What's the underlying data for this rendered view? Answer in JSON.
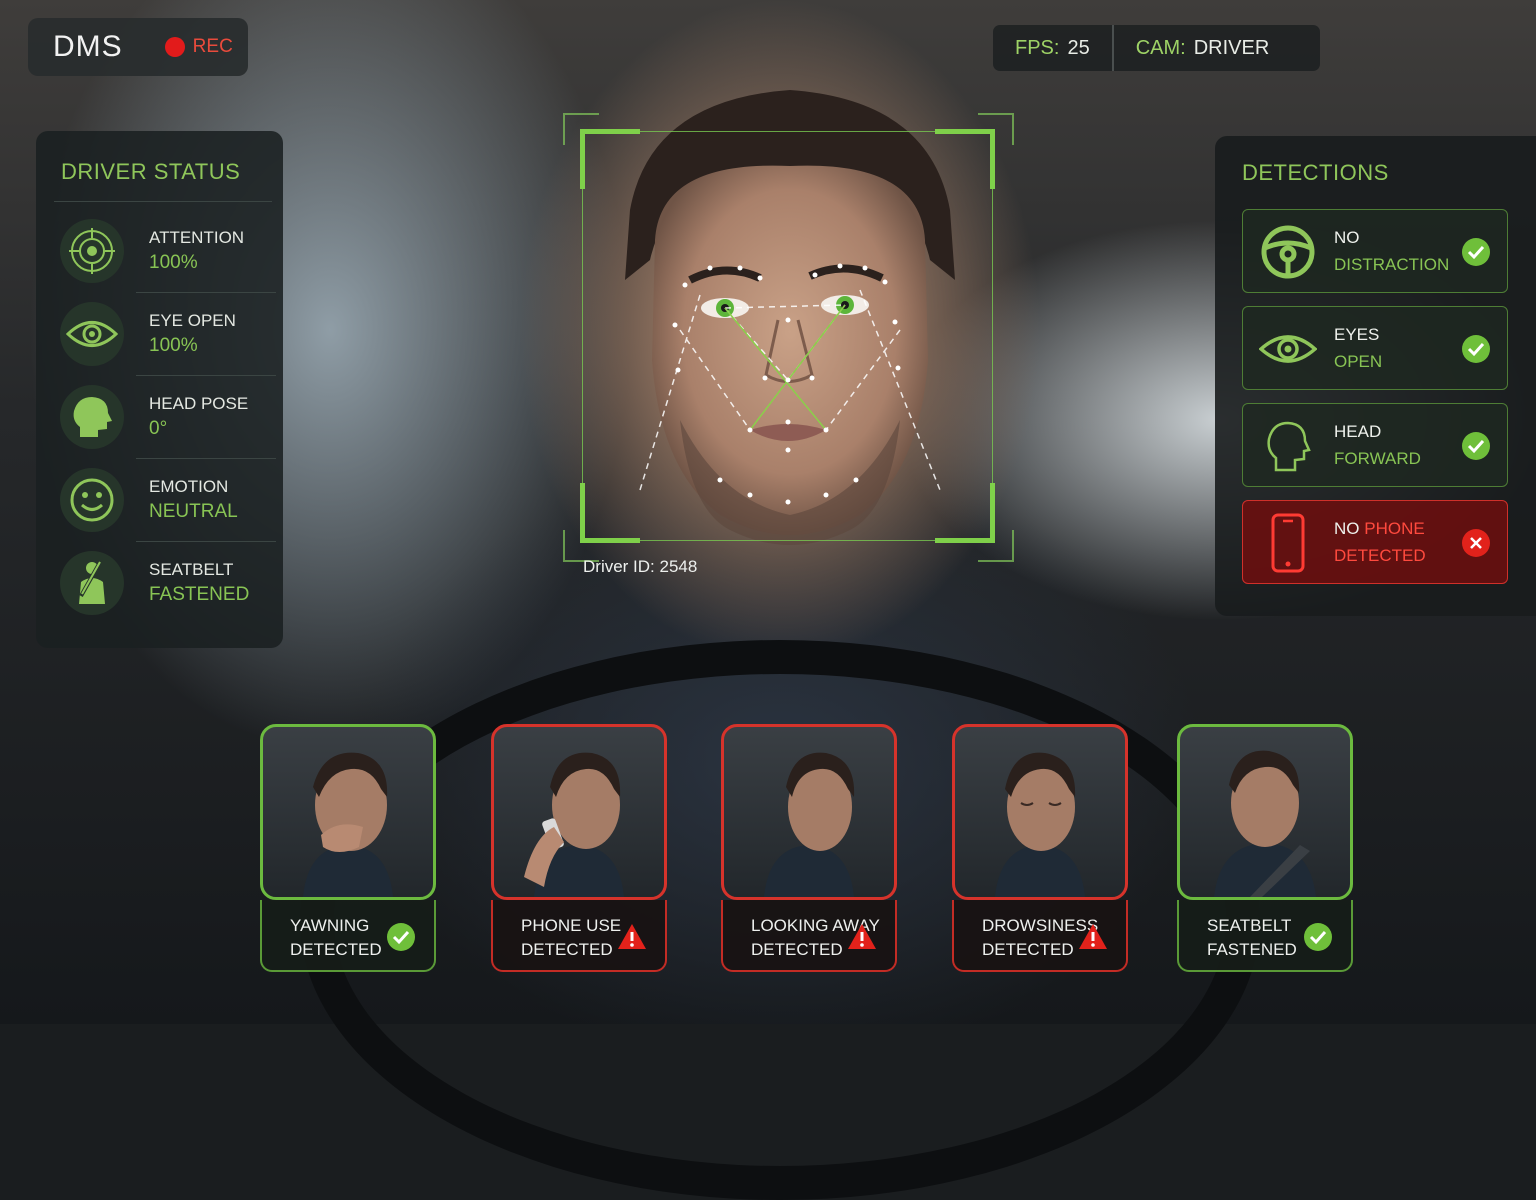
{
  "header": {
    "title": "DMS",
    "rec_label": "REC"
  },
  "topbar": {
    "fps_label": "FPS:",
    "fps_value": "25",
    "cam_label": "CAM:",
    "cam_value": "DRIVER"
  },
  "driver_status": {
    "title": "DRIVER STATUS",
    "items": [
      {
        "label": "ATTENTION",
        "value": "100%",
        "icon": "target-icon"
      },
      {
        "label": "EYE OPEN",
        "value": "100%",
        "icon": "eye-icon"
      },
      {
        "label": "HEAD POSE",
        "value": "0°",
        "icon": "head-icon"
      },
      {
        "label": "EMOTION",
        "value": "NEUTRAL",
        "icon": "smiley-icon"
      },
      {
        "label": "SEATBELT",
        "value": "FASTENED",
        "icon": "seatbelt-icon"
      }
    ]
  },
  "detections": {
    "title": "DETECTIONS",
    "items": [
      {
        "line1": "NO",
        "line2": "DISTRACTION",
        "icon": "steering-wheel-icon",
        "status": "ok"
      },
      {
        "line1": "EYES",
        "line2": "OPEN",
        "icon": "eye-icon",
        "status": "ok"
      },
      {
        "line1": "HEAD",
        "line2": "FORWARD",
        "icon": "head-icon",
        "status": "ok"
      },
      {
        "line1a": "NO",
        "line1b": "PHONE",
        "line2": "DETECTED",
        "icon": "phone-icon",
        "status": "alert"
      }
    ]
  },
  "face_tracking": {
    "driver_id": "Driver ID: 2548"
  },
  "events": [
    {
      "line1": "YAWNING",
      "line2": "DETECTED",
      "status": "ok"
    },
    {
      "line1": "PHONE USE",
      "line2": "DETECTED",
      "status": "warning"
    },
    {
      "line1": "LOOKING AWAY",
      "line2": "DETECTED",
      "status": "warning"
    },
    {
      "line1": "DROWSINESS",
      "line2": "DETECTED",
      "status": "warning"
    },
    {
      "line1": "SEATBELT",
      "line2": "FASTENED",
      "status": "ok"
    }
  ],
  "colors": {
    "accent_green": "#88c454",
    "alert_red": "#e0302a",
    "panel_bg": "#1a2021"
  }
}
